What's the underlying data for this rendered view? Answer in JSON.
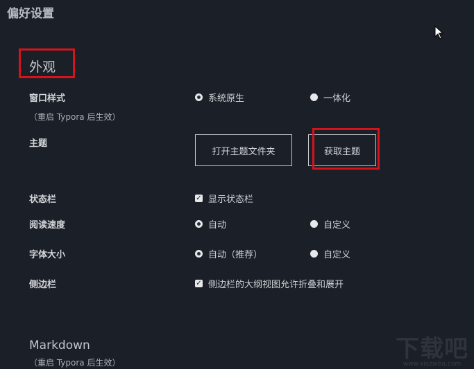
{
  "window": {
    "title": "偏好设置"
  },
  "appearance": {
    "section_title": "外观",
    "window_style": {
      "label": "窗口样式",
      "hint": "（重启 Typora 后生效）",
      "options": [
        "系统原生",
        "一体化"
      ],
      "selected": "系统原生"
    },
    "theme": {
      "label": "主题",
      "open_folder_button": "打开主题文件夹",
      "get_theme_button": "获取主题"
    },
    "status_bar": {
      "label": "状态栏",
      "checkbox_label": "显示状态栏",
      "checked": true
    },
    "reading_speed": {
      "label": "阅读速度",
      "options": [
        "自动",
        "自定义"
      ],
      "selected": "自动"
    },
    "font_size": {
      "label": "字体大小",
      "options": [
        "自动（推荐）",
        "自定义"
      ],
      "selected": "自动（推荐）"
    },
    "sidebar": {
      "label": "侧边栏",
      "checkbox_label": "侧边栏的大纲视图允许折叠和展开",
      "checked": true
    }
  },
  "markdown": {
    "section_title": "Markdown",
    "hint": "（重启 Typora 后生效）"
  },
  "watermark": {
    "text": "下载吧",
    "url": "www.xiazaiba.com"
  },
  "colors": {
    "background": "#1b1f27",
    "highlight": "#d4131b",
    "text": "#c9ccd2"
  },
  "icons": [
    "cursor-icon",
    "radio-icon",
    "checkbox-icon"
  ]
}
